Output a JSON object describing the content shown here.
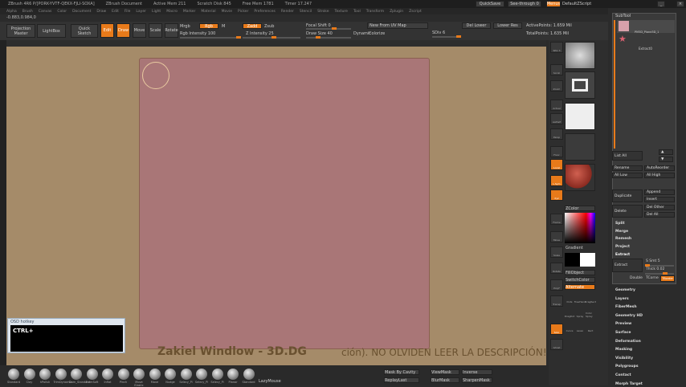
{
  "titlebar": {
    "app": "ZBrush 4R6 P/[PORK-YVTF-QEKX-FJLI-SOXA]",
    "doc": "ZBrush Document",
    "stats": [
      "Active Mem 211",
      "Scratch Disk 845",
      "Free Mem 1781",
      "Timer 17.247"
    ]
  },
  "menu": [
    "Alpha",
    "Brush",
    "Canvas",
    "Color",
    "Document",
    "Draw",
    "Edit",
    "File",
    "Layer",
    "Light",
    "Macro",
    "Marker",
    "Material",
    "Movie",
    "Picker",
    "Preferences",
    "Render",
    "Stencil",
    "Stroke",
    "Texture",
    "Tool",
    "Transform",
    "Zplugin",
    "Zscript"
  ],
  "coords": "-0.883,0.984,0",
  "topright": {
    "quicksave": "QuickSave",
    "see_through": "See-through 0",
    "menus": "Menus",
    "script": "DefaultZScript"
  },
  "toolbar": {
    "projection_master": "Projection Master",
    "lightbox": "LightBox",
    "quick_sketch": "Quick Sketch",
    "edit": "Edit",
    "draw": "Draw",
    "move": "Move",
    "scale": "Scale",
    "rotate": "Rotate",
    "mrgb": "Mrgb",
    "rgb": "Rgb",
    "m": "M",
    "zadd": "Zadd",
    "zsub": "Zsub",
    "rgb_intensity": "Rgb Intensity 100",
    "z_intensity": "Z Intensity 25",
    "focal_shift": "Focal Shift 0",
    "draw_size": "Draw Size 40",
    "dynamic": "Dynamic",
    "new_from_uv": "New From UV Map",
    "colorize": "Colorize",
    "sdiv": "SDiv 6",
    "del_lower": "Del Lower",
    "lower_res": "Lower Res",
    "active_points": "ActivePoints: 1.659 Mil",
    "total_points": "TotalPoints: 1.635 Mil"
  },
  "osd": {
    "title": "OSD hotkey",
    "text": "CTRL+"
  },
  "watermark": {
    "main": "Zakiel Windlow - 3D.DG",
    "sub": "ción).   NO OLVIDEN LEER LA DESCRIPCIÓN!"
  },
  "brushes": [
    "Standard",
    "Clay",
    "hPolish",
    "TrimDynamic",
    "Dam_Standard",
    "FormSoft",
    "Inflat",
    "Pinch",
    "Move Elastic",
    "Move",
    "Nudge",
    "Selecy_Pi",
    "Selecy_Pi",
    "Selecy_Pi",
    "Planar",
    "Standard"
  ],
  "bottom": {
    "lazymouse": "LazyMouse",
    "mask_by_cavity": "Mask By Cavity",
    "replay_last": "ReplayLast",
    "viewmask": "ViewMask",
    "blurmask": "BlurMask",
    "inverse": "Inverse",
    "sharpenmask": "SharpenMask"
  },
  "rightcol": {
    "spix": "SPix 3",
    "scroll": "Scroll",
    "zoom": "Zoom",
    "actual": "Actual",
    "aahalf": "AAHalf",
    "persp": "Persp",
    "floor": "Floor",
    "local": "Local",
    "lsym": "L.Sym",
    "xyz": "Xyz",
    "frame": "Frame",
    "move": "Move",
    "scale": "Scale",
    "rotate": "Rotate",
    "polyf": "PolyF",
    "transp": "Transp",
    "solo": "Solo",
    "ghost": "Ghost"
  },
  "palette": {
    "zcolor": "ZColor",
    "gradient": "Gradient",
    "fill_object": "FillObject",
    "switch_color": "SwitchColor",
    "alternate": "Alternate",
    "strokes": [
      "Dots",
      "FreeHand",
      "DragRect",
      "DragDot",
      "Spray",
      "Color Spray",
      "Curve",
      "Lasso",
      "Rect"
    ]
  },
  "subtool": {
    "title": "SubTool",
    "items": [
      "PM3D_Plane3D_1",
      "Extract0"
    ],
    "list_all": "List All",
    "rename": "Rename",
    "autoreorder": "AutoReorder",
    "all_low": "All Low",
    "all_high": "All High",
    "duplicate": "Duplicate",
    "append": "Append",
    "insert": "Insert",
    "delete": "Delete",
    "del_other": "Del Other",
    "del_all": "Del All",
    "split": "Split",
    "merge": "Merge",
    "remesh": "Remesh",
    "project": "Project",
    "extract_section": "Extract",
    "extract_btn": "Extract",
    "s_smt": "S Smt 5",
    "thick": "Thick 0.02",
    "double": "Double",
    "tcorne": "TCorne",
    "tborder": "TBorder"
  },
  "tool_sections": [
    "Geometry",
    "Layers",
    "FiberMesh",
    "Geometry HD",
    "Preview",
    "Surface",
    "Deformation",
    "Masking",
    "Visibility",
    "Polygroups",
    "Contact",
    "Morph Target"
  ],
  "colors": {
    "accent": "#e87a1a",
    "canvas": "#a58b69",
    "document": "#a97677"
  }
}
